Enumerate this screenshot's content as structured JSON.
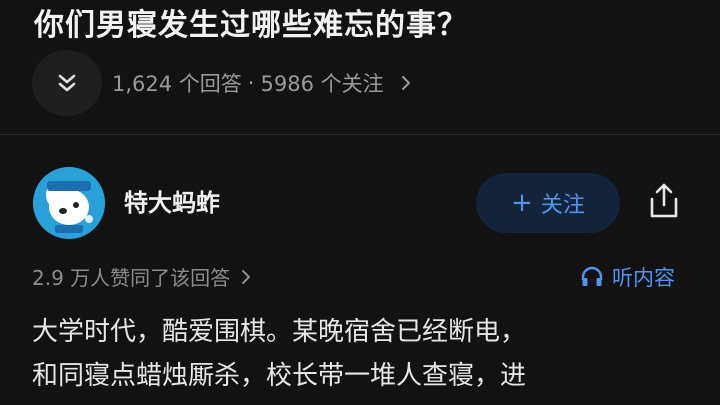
{
  "question": {
    "title": "你们男寝发生过哪些难忘的事？",
    "answers": "1,624 个回答",
    "separator": "·",
    "followers": "5986 个关注"
  },
  "author": {
    "name": "特大蚂蚱"
  },
  "actions": {
    "follow_plus": "+",
    "follow_label": "关注"
  },
  "answer": {
    "likes_text": "2.9 万人赞同了该回答",
    "listen_label": "听内容",
    "lines": [
      "大学时代，酷爱围棋。某晚宿舍已经断电，",
      "和同寝点蜡烛厮杀，校长带一堆人查寝，进"
    ]
  },
  "colors": {
    "background": "#121212",
    "accent": "#4f95ee",
    "follow_bg": "#13233a",
    "muted": "#9a9a9a"
  },
  "icons": [
    "double-chevron-down-icon",
    "chevron-right-icon",
    "avatar-dog-icon",
    "share-icon",
    "headphones-icon"
  ]
}
